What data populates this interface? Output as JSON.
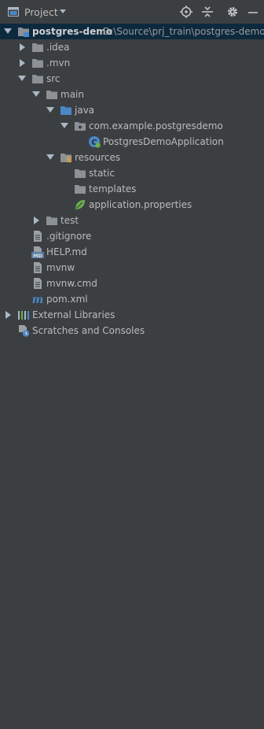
{
  "toolbar": {
    "title": "Project",
    "panel_icon": "project-panel-icon",
    "buttons": [
      "locate-icon",
      "collapse-all-icon",
      "gear-icon",
      "minimize-icon"
    ]
  },
  "tree": {
    "root": {
      "label": "postgres-demo",
      "path": "D:\\Source\\prj_train\\postgres-demo"
    },
    "idea": ".idea",
    "mvn": ".mvn",
    "src": "src",
    "main": "main",
    "java": "java",
    "package": "com.example.postgresdemo",
    "app_class": "PostgresDemoApplication",
    "resources": "resources",
    "static": "static",
    "templates": "templates",
    "app_props": "application.properties",
    "test": "test",
    "gitignore": ".gitignore",
    "help": "HELP.md",
    "mvnw": "mvnw",
    "mvnw_cmd": "mvnw.cmd",
    "pom": "pom.xml",
    "external_libs": "External Libraries",
    "scratches": "Scratches and Consoles"
  },
  "colors": {
    "background": "#3c3f41",
    "selection": "#0d293e",
    "text": "#bbbbbb",
    "folder": "#8c9196",
    "source_folder": "#4a88c7",
    "spring": "#6ab04c"
  }
}
